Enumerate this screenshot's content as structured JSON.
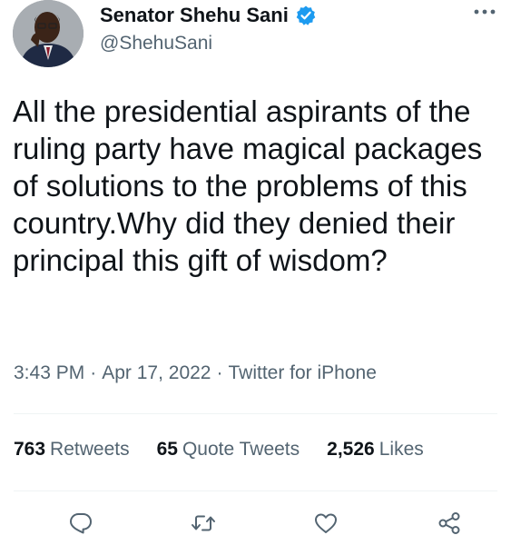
{
  "author": {
    "display_name": "Senator Shehu Sani",
    "handle": "@ShehuSani",
    "verified": true
  },
  "tweet": {
    "text": "All the presidential aspirants of the ruling party have magical packages of solutions to the problems of this country.Why did they denied their principal this gift of wisdom?",
    "time": "3:43 PM",
    "date": "Apr 17, 2022",
    "source": "Twitter for iPhone",
    "separator": "·"
  },
  "stats": {
    "retweets_count": "763",
    "retweets_label": "Retweets",
    "quotes_count": "65",
    "quotes_label": "Quote Tweets",
    "likes_count": "2,526",
    "likes_label": "Likes"
  },
  "actions": [
    "reply-icon",
    "retweet-icon",
    "like-icon",
    "share-icon"
  ],
  "colors": {
    "text": "#0f1419",
    "secondary": "#536471",
    "verified": "#1d9bf0",
    "divider": "#eff3f4"
  }
}
